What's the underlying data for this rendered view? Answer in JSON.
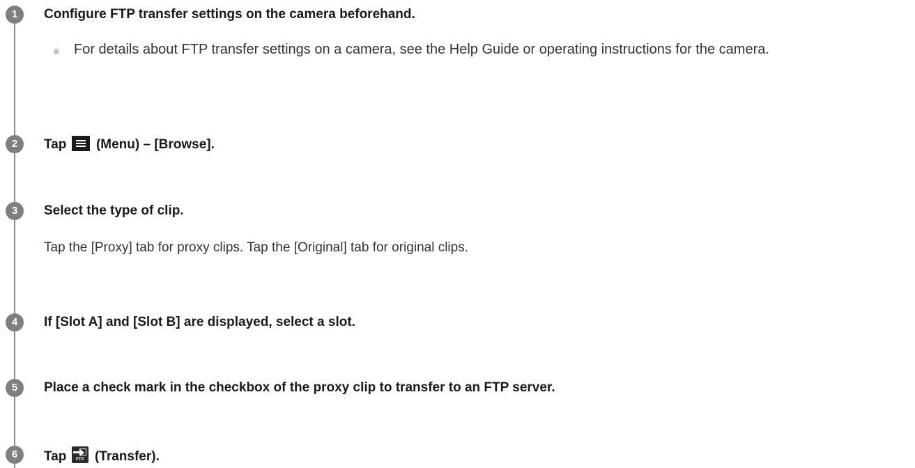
{
  "steps": [
    {
      "number": "1",
      "title": "Configure FTP transfer settings on the camera beforehand.",
      "note": "For details about FTP transfer settings on a camera, see the Help Guide or operating instructions for the camera."
    },
    {
      "number": "2",
      "title_before": "Tap",
      "icon": "menu-icon",
      "title_after": "(Menu) – [Browse]."
    },
    {
      "number": "3",
      "title": "Select the type of clip.",
      "body": "Tap the [Proxy] tab for proxy clips. Tap the [Original] tab for original clips."
    },
    {
      "number": "4",
      "title": "If [Slot A] and [Slot B] are displayed, select a slot."
    },
    {
      "number": "5",
      "title": "Place a check mark in the checkbox of the proxy clip to transfer to an FTP server."
    },
    {
      "number": "6",
      "title_before": "Tap",
      "icon": "ftp-transfer-icon",
      "icon_label": "FTP",
      "title_after": "(Transfer)."
    }
  ]
}
